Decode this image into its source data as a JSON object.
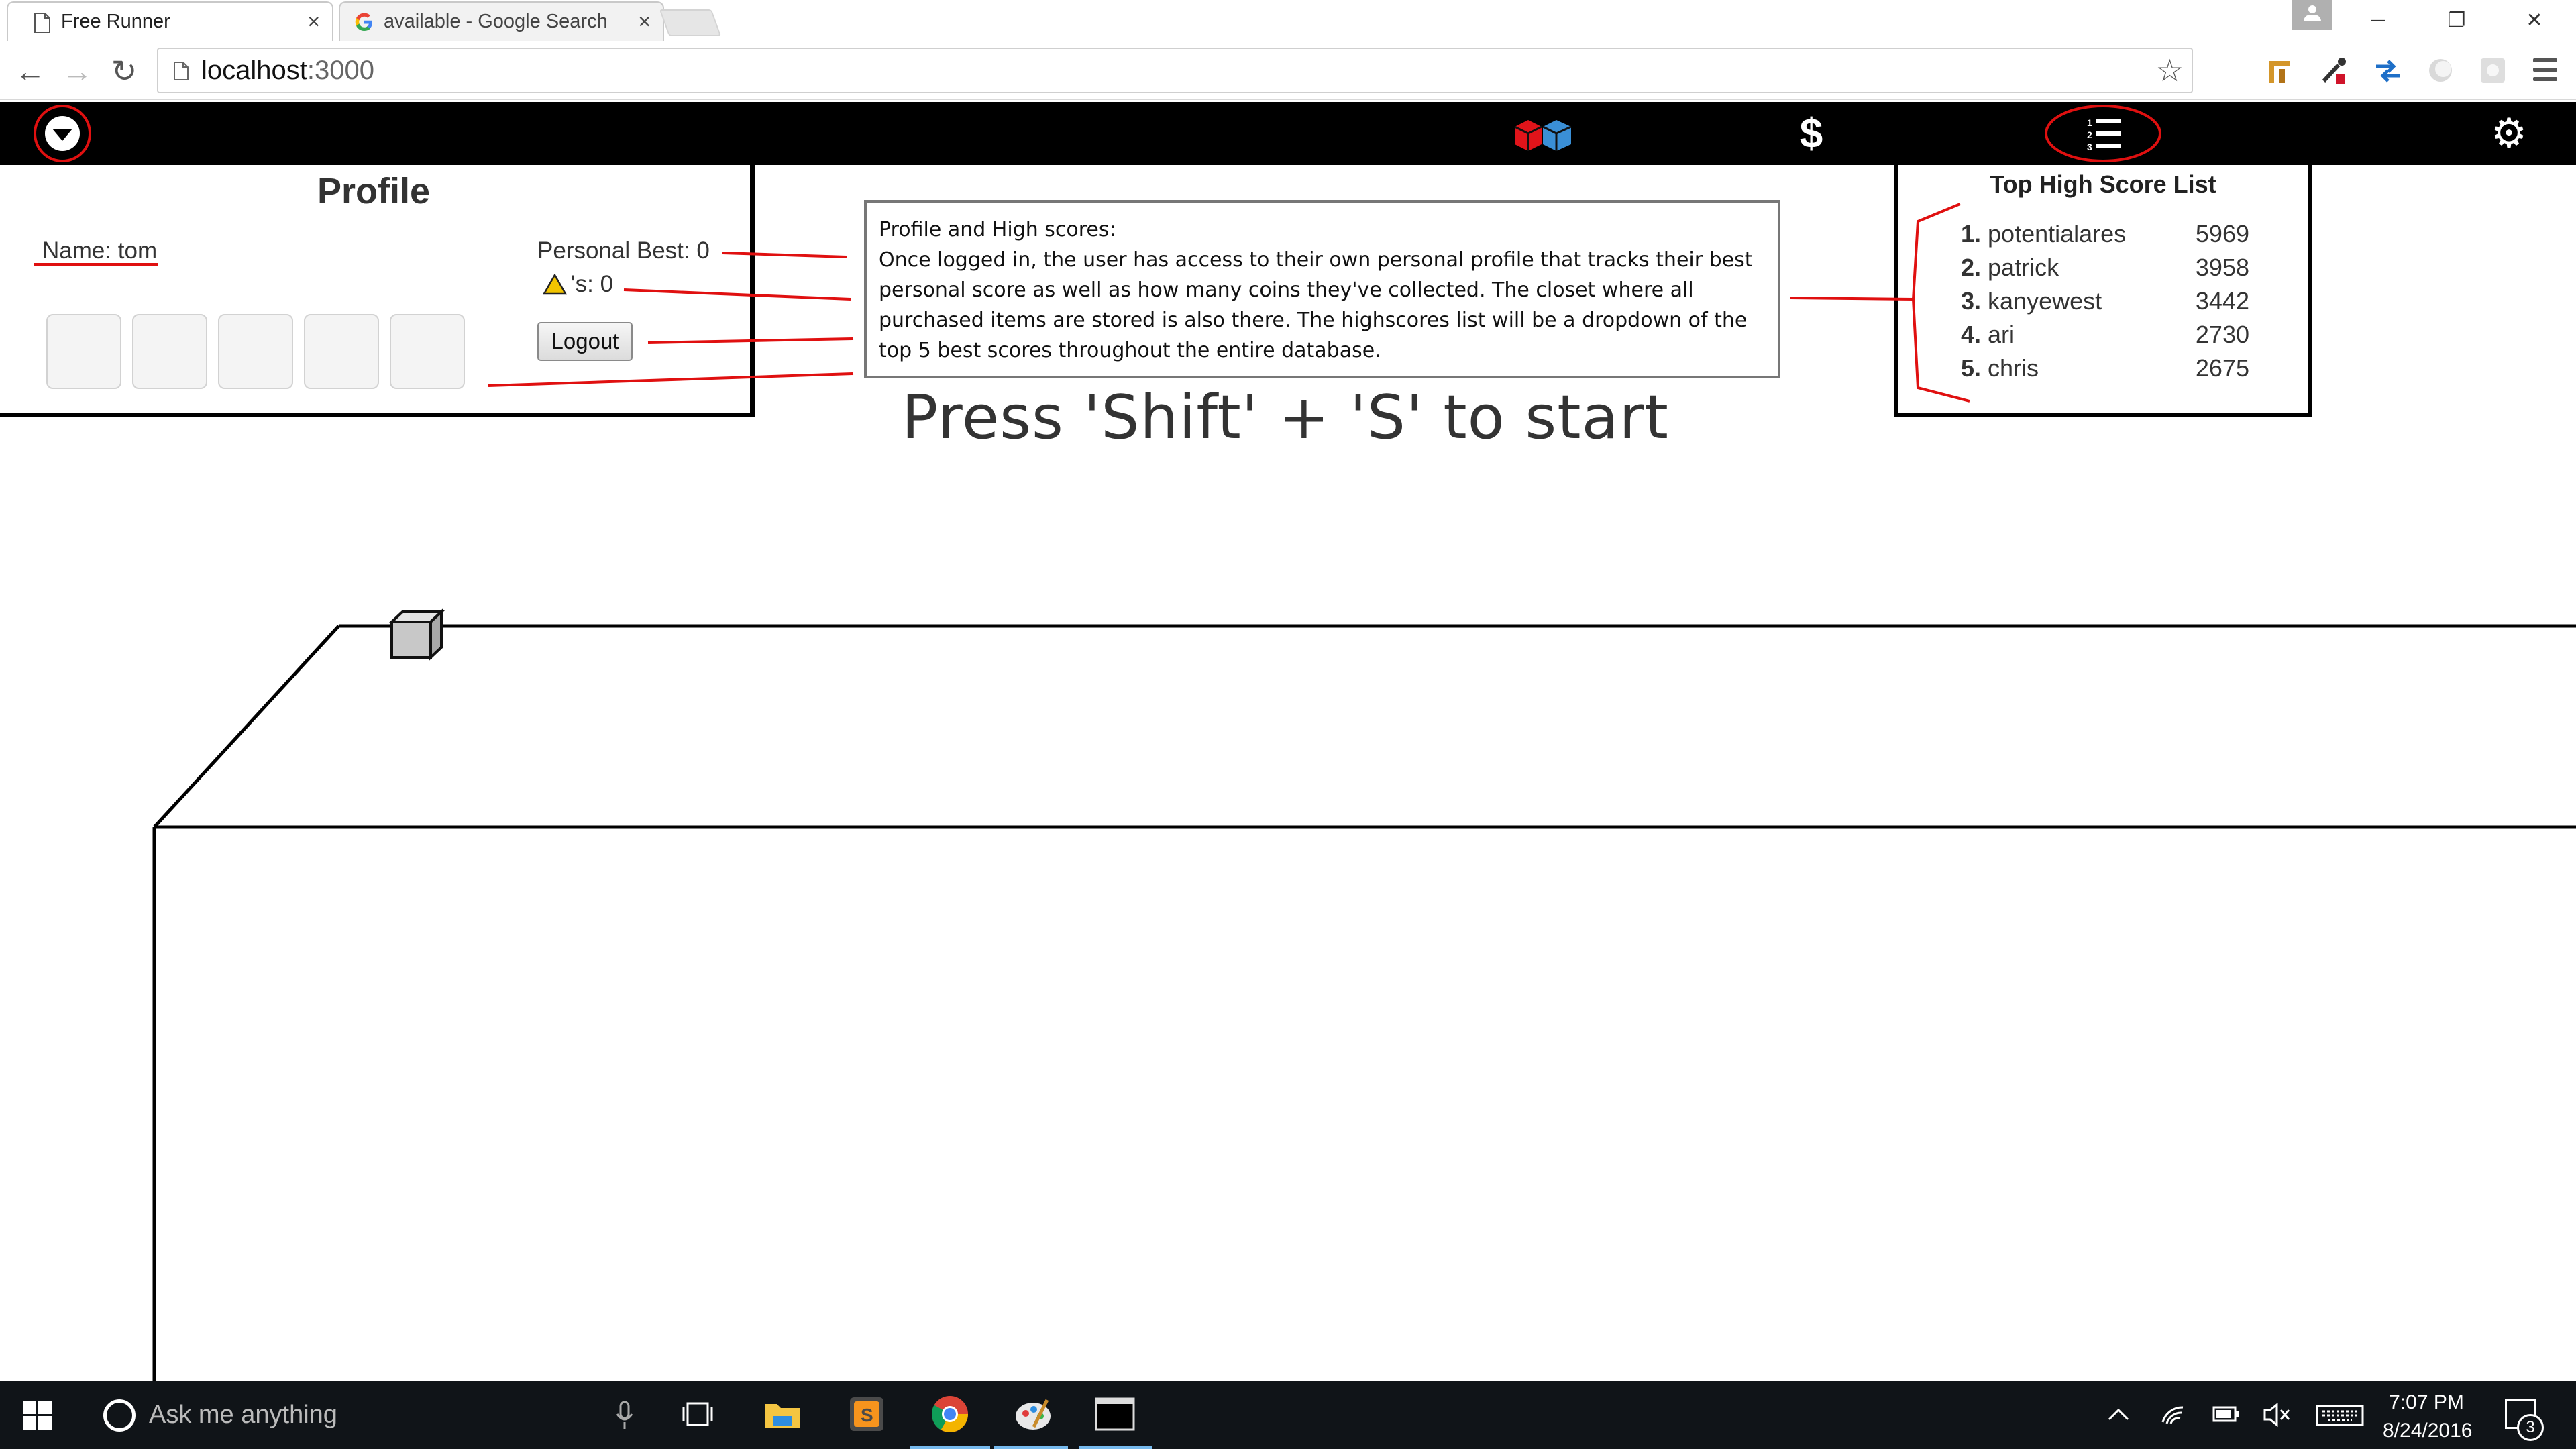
{
  "browser": {
    "tabs": [
      {
        "label": "Free Runner",
        "close": "×"
      },
      {
        "label": "available - Google Search",
        "close": "×"
      }
    ],
    "window_controls": {
      "minimize": "─",
      "restore": "❐",
      "close": "✕"
    },
    "nav": {
      "back": "←",
      "forward": "→",
      "reload": "↻"
    },
    "url": {
      "host": "localhost",
      "port": ":3000"
    },
    "bookmark_star": "☆"
  },
  "app_nav": {
    "items": [
      "dropdown-toggle",
      "closet",
      "coins",
      "high-scores",
      "settings"
    ],
    "coins_symbol": "$",
    "settings_symbol": "⚙",
    "annotation_color": "#e01010"
  },
  "profile": {
    "title": "Profile",
    "name_label": "Name: tom",
    "personal_best": "Personal Best: 0",
    "coins_suffix": "'s: 0",
    "logout_label": "Logout",
    "slots": 5
  },
  "note": {
    "title": "Profile and High scores:",
    "body": "Once logged in, the user has access to their own personal profile that tracks their best personal score as well as how many coins they've collected. The closet where all purchased items are stored is also there. The highscores list will be a dropdown of the top 5 best scores throughout the entire database."
  },
  "start_prompt": "Press 'Shift' + 'S' to start",
  "high_scores": {
    "title": "Top High Score List",
    "entries": [
      {
        "rank": "1.",
        "name": "potentialares",
        "score": "5969"
      },
      {
        "rank": "2.",
        "name": "patrick",
        "score": "3958"
      },
      {
        "rank": "3.",
        "name": "kanyewest",
        "score": "3442"
      },
      {
        "rank": "4.",
        "name": "ari",
        "score": "2730"
      },
      {
        "rank": "5.",
        "name": "chris",
        "score": "2675"
      }
    ]
  },
  "taskbar": {
    "search_placeholder": "Ask me anything",
    "clock_time": "7:07 PM",
    "clock_date": "8/24/2016",
    "notification_count": "3"
  }
}
